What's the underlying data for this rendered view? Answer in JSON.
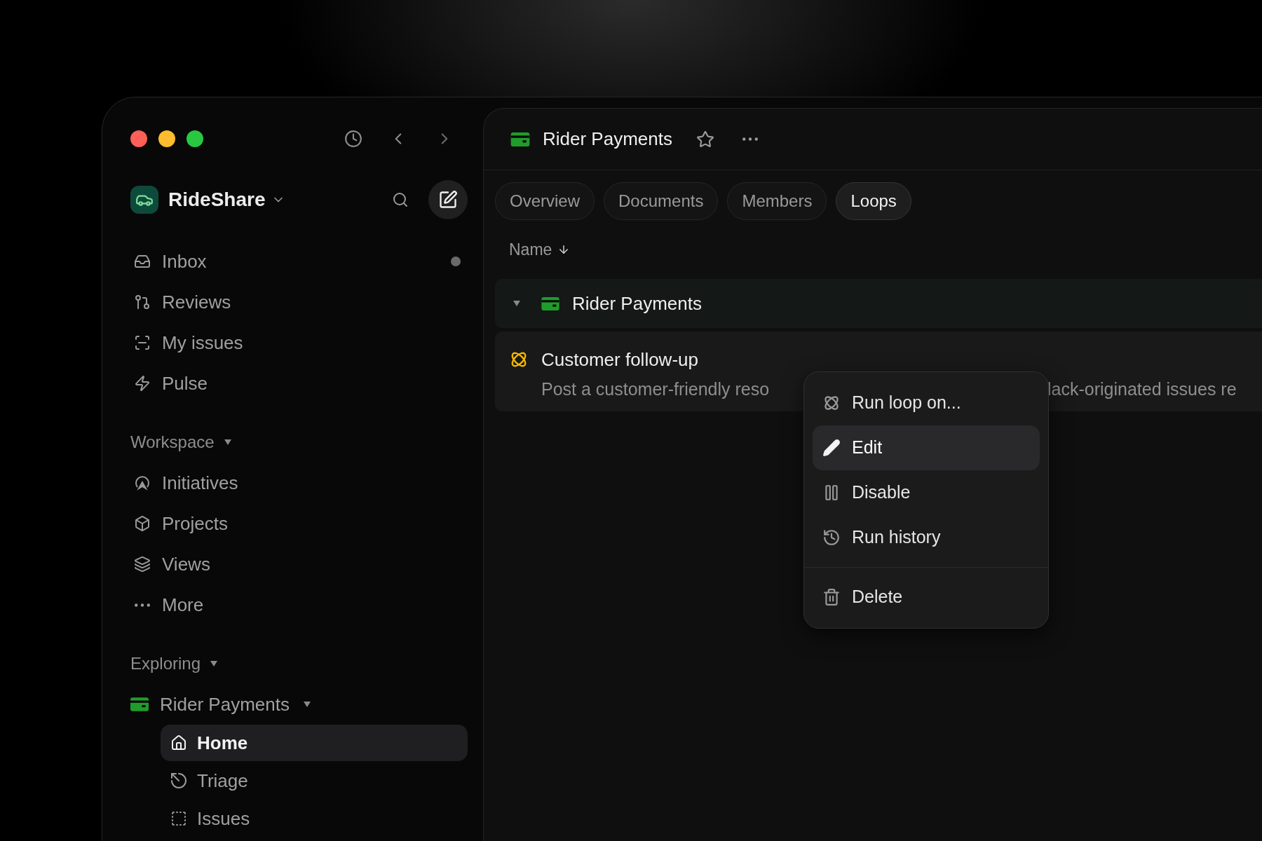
{
  "workspace": {
    "name": "RideShare"
  },
  "sidebar": {
    "items": [
      {
        "label": "Inbox",
        "unread": true
      },
      {
        "label": "Reviews",
        "unread": false
      },
      {
        "label": "My issues",
        "unread": false
      },
      {
        "label": "Pulse",
        "unread": false
      }
    ],
    "sections": [
      {
        "title": "Workspace",
        "expanded": true,
        "items": [
          {
            "label": "Initiatives"
          },
          {
            "label": "Projects"
          },
          {
            "label": "Views"
          },
          {
            "label": "More"
          }
        ]
      },
      {
        "title": "Exploring",
        "expanded": true,
        "items": [
          {
            "label": "Rider Payments",
            "expanded": true,
            "children": [
              {
                "label": "Home",
                "selected": true
              },
              {
                "label": "Triage",
                "selected": false
              },
              {
                "label": "Issues",
                "selected": false
              }
            ]
          }
        ]
      }
    ]
  },
  "header": {
    "title": "Rider Payments",
    "starred": false
  },
  "tabs": [
    {
      "label": "Overview",
      "selected": false
    },
    {
      "label": "Documents",
      "selected": false
    },
    {
      "label": "Members",
      "selected": false
    },
    {
      "label": "Loops",
      "selected": true
    }
  ],
  "table": {
    "sort_column": "Name",
    "group": {
      "name": "Rider Payments",
      "expanded": true
    },
    "rows": [
      {
        "title": "Customer follow-up",
        "description_start": "Post a customer-friendly reso",
        "description_end": "lack-originated issues re"
      }
    ]
  },
  "context_menu": {
    "groups": [
      [
        {
          "label": "Run loop on...",
          "selected": false
        },
        {
          "label": "Edit",
          "selected": true
        },
        {
          "label": "Disable",
          "selected": false
        },
        {
          "label": "Run history",
          "selected": false
        }
      ],
      [
        {
          "label": "Delete",
          "selected": false
        }
      ]
    ]
  }
}
